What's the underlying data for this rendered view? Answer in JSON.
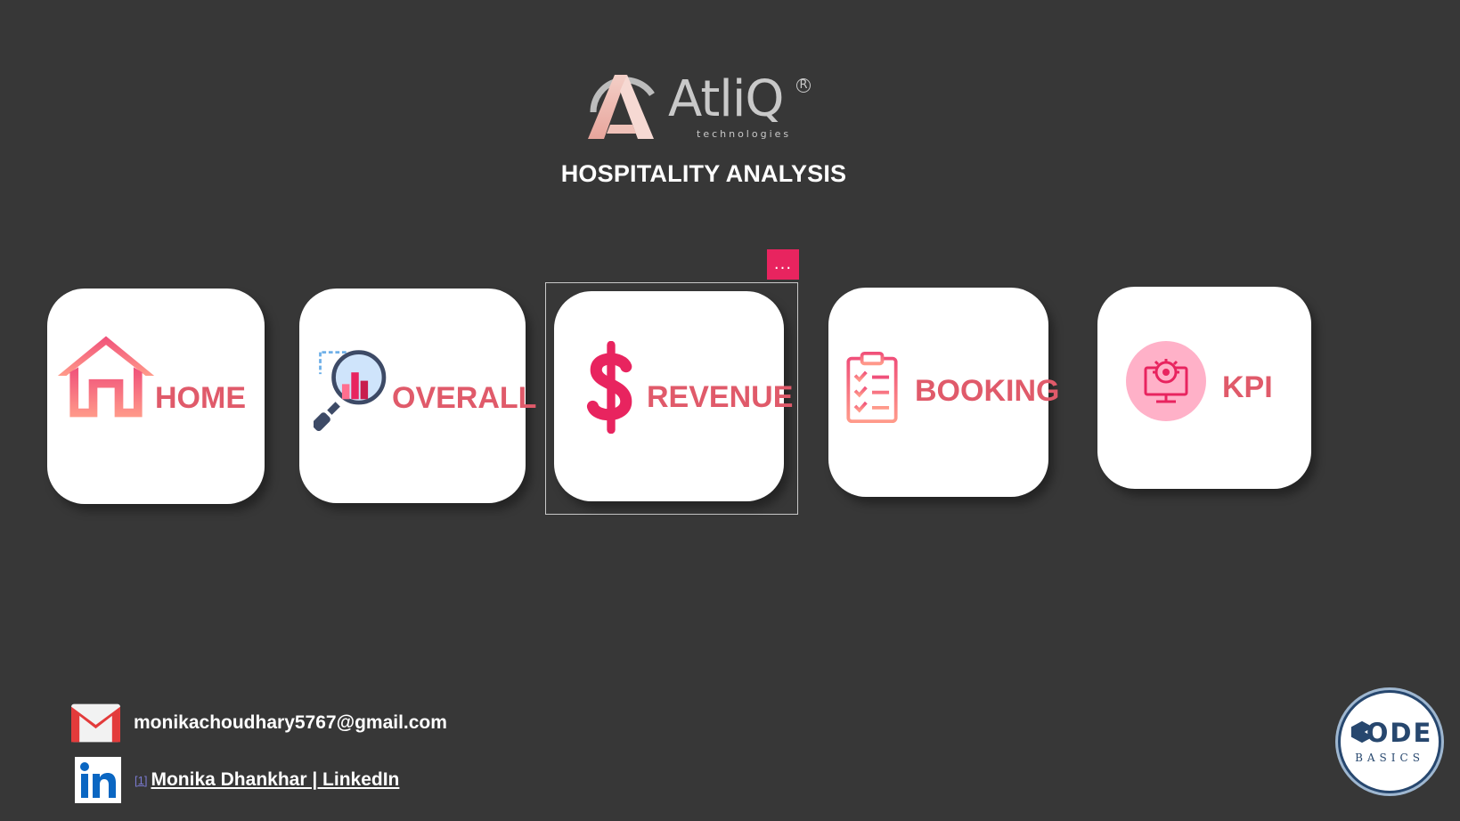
{
  "brand": {
    "wordmark": "AtliQ",
    "tagline": "technologies",
    "registered_mark": "R"
  },
  "page": {
    "title": "HOSPITALITY ANALYSIS"
  },
  "nav_cards": [
    {
      "label": "HOME",
      "icon": "house-icon"
    },
    {
      "label": "OVERALL",
      "icon": "magnifier-chart-icon"
    },
    {
      "label": "REVENUE",
      "icon": "dollar-icon"
    },
    {
      "label": "BOOKING",
      "icon": "clipboard-checklist-icon"
    },
    {
      "label": "KPI",
      "icon": "monitor-gear-icon"
    }
  ],
  "selection": {
    "more_label": "..."
  },
  "contact": {
    "email": "monikachoudhary5767@gmail.com",
    "email_icon": "gmail-icon",
    "linkedin_index": "[1]",
    "linkedin_label": "Monika Dhankhar | LinkedIn",
    "linkedin_icon": "linkedin-icon"
  },
  "badge": {
    "main": "ODE",
    "sub": "BASICS",
    "icon": "codebasics-logo"
  },
  "colors": {
    "background": "#373737",
    "card": "#ffffff",
    "label": "#e05a6a",
    "accent": "#e8245f"
  }
}
